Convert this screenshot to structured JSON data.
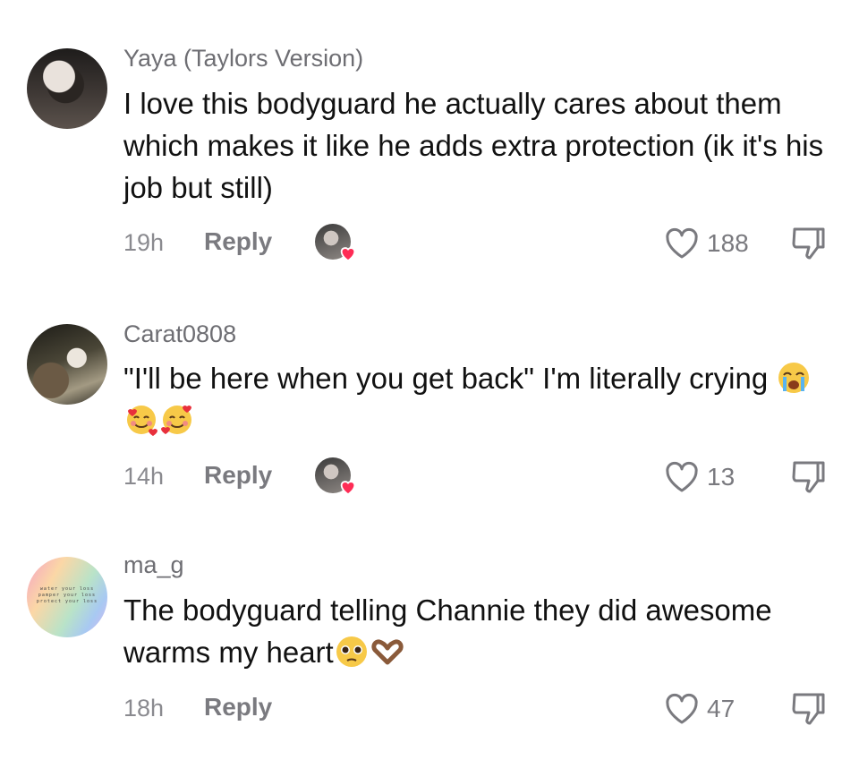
{
  "comments": [
    {
      "username": "Yaya (Taylors Version)",
      "text": "I love this bodyguard he actually cares about them which makes it like he adds extra protection (ik it's his job but still)",
      "time": "19h",
      "reply_label": "Reply",
      "likes": "188",
      "avatar_icon": "avatar-photo"
    },
    {
      "username": "Carat0808",
      "text": "\"I'll be here when you get back\" I'm literally crying",
      "emojis": [
        "loudly-crying-face",
        "smiling-face-with-hearts",
        "smiling-face-with-hearts"
      ],
      "time": "14h",
      "reply_label": "Reply",
      "likes": "13",
      "avatar_icon": "avatar-photo"
    },
    {
      "username": "ma_g",
      "text": "The bodyguard telling Channie they did awesome warms my heart",
      "emojis": [
        "pleading-face",
        "heart-hands"
      ],
      "time": "18h",
      "reply_label": "Reply",
      "likes": "47",
      "avatar_watermark": [
        "water your loss",
        "pamper your loss",
        "protect your loss"
      ]
    }
  ],
  "colors": {
    "heart_red": "#fe2c55",
    "muted_text": "#7a7a7f",
    "body_text": "#111111"
  }
}
